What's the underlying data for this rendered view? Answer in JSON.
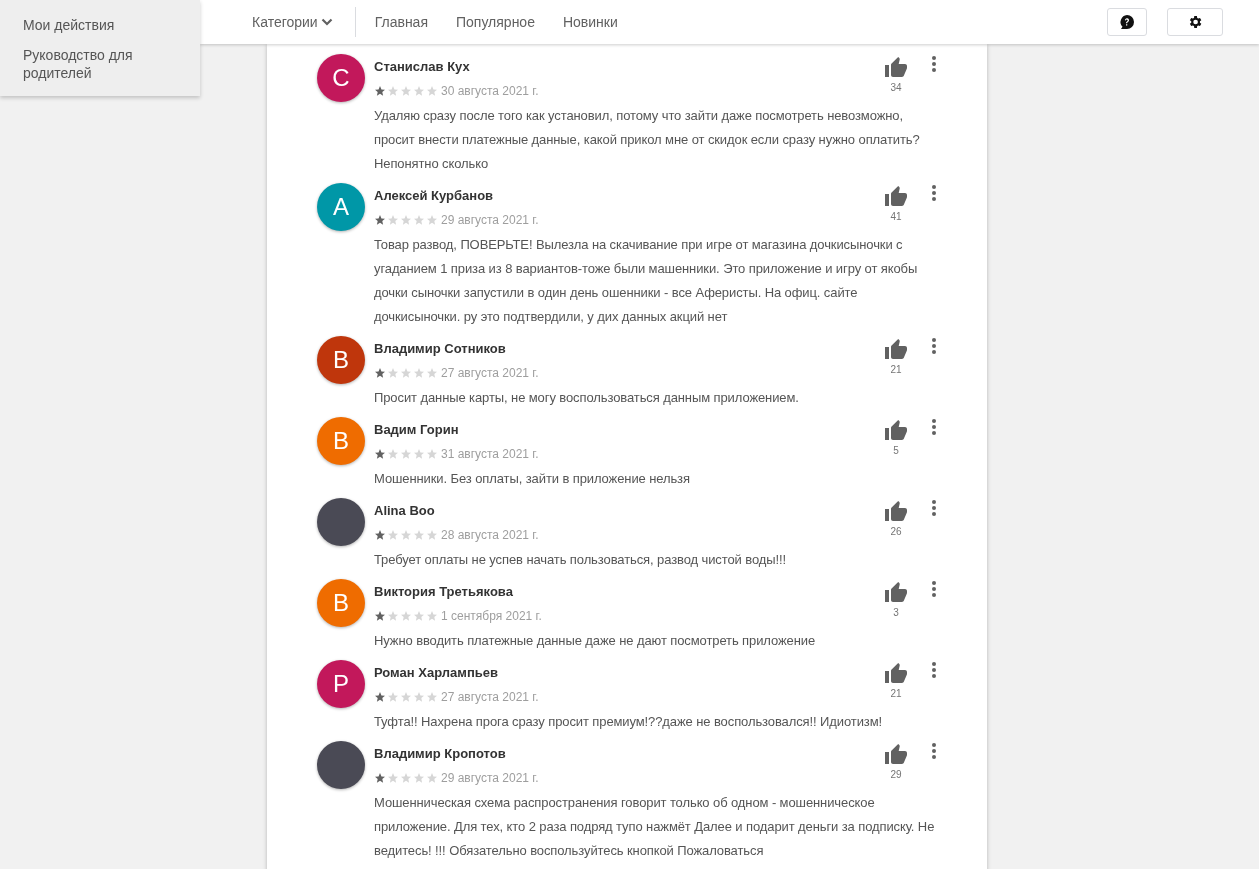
{
  "sidebar": {
    "items": [
      {
        "label": "Мои действия"
      },
      {
        "label": "Руководство для родителей"
      }
    ]
  },
  "header": {
    "nav": [
      {
        "kind": "dropdown",
        "label": "Категории"
      },
      {
        "kind": "link",
        "label": "Главная"
      },
      {
        "kind": "link",
        "label": "Популярное"
      },
      {
        "kind": "link",
        "label": "Новинки"
      }
    ]
  },
  "reviews": [
    {
      "author": "Станислав Кух",
      "avatar": {
        "kind": "letter",
        "letter": "С",
        "color": "#c2185b"
      },
      "stars": 1,
      "date": "30 августа 2021 г.",
      "likes": "34",
      "text": "Удаляю сразу после того как установил, потому что зайти даже посмотреть невозможно, просит внести платежные данные, какой прикол мне от скидок если сразу нужно оплатить? Непонятно сколько"
    },
    {
      "author": "Алексей Курбанов",
      "avatar": {
        "kind": "letter",
        "letter": "А",
        "color": "#0097a7"
      },
      "stars": 1,
      "date": "29 августа 2021 г.",
      "likes": "41",
      "text": "Товар развод, ПОВЕРЬТЕ! Вылезла на скачивание при игре от магазина дочкисыночки с угаданием 1 приза из 8 вариантов-тоже были машенники. Это приложение и игру от якобы дочки сыночки запустили в один день ошенники - все Аферисты. На офиц. сайте дочкисыночки. ру это подтвердили, у дих данных акций нет"
    },
    {
      "author": "Владимир Сотников",
      "avatar": {
        "kind": "letter",
        "letter": "В",
        "color": "#bf360c"
      },
      "stars": 1,
      "date": "27 августа 2021 г.",
      "likes": "21",
      "text": "Просит данные карты, не могу воспользоваться данным приложением."
    },
    {
      "author": "Вадим Горин",
      "avatar": {
        "kind": "letter",
        "letter": "В",
        "color": "#ef6c00"
      },
      "stars": 1,
      "date": "31 августа 2021 г.",
      "likes": "5",
      "text": "Мошенники. Без оплаты, зайти в приложение нельзя"
    },
    {
      "author": "Alina Boo",
      "avatar": {
        "kind": "photo"
      },
      "stars": 1,
      "date": "28 августа 2021 г.",
      "likes": "26",
      "text": "Требует оплаты не успев начать пользоваться, развод чистой воды!!!"
    },
    {
      "author": "Виктория Третьякова",
      "avatar": {
        "kind": "letter",
        "letter": "В",
        "color": "#ef6c00"
      },
      "stars": 1,
      "date": "1 сентября 2021 г.",
      "likes": "3",
      "text": "Нужно вводить платежные данные даже не дают посмотреть приложение"
    },
    {
      "author": "Роман Харлампьев",
      "avatar": {
        "kind": "letter",
        "letter": "Р",
        "color": "#c2185b"
      },
      "stars": 1,
      "date": "27 августа 2021 г.",
      "likes": "21",
      "text": "Туфта!! Нахрена прога сразу просит премиум!??даже не воспользовался!! Идиотизм!"
    },
    {
      "author": "Владимир Кропотов",
      "avatar": {
        "kind": "photo"
      },
      "stars": 1,
      "date": "29 августа 2021 г.",
      "likes": "29",
      "text": "Мошенническая схема распространения говорит только об одном - мошенническое приложение. Для тех, кто 2 раза подряд тупо нажмёт Далее и подарит деньги за подписку. Не ведитесь! !!! Обязательно воспользуйтесь кнопкой Пожаловаться"
    }
  ]
}
